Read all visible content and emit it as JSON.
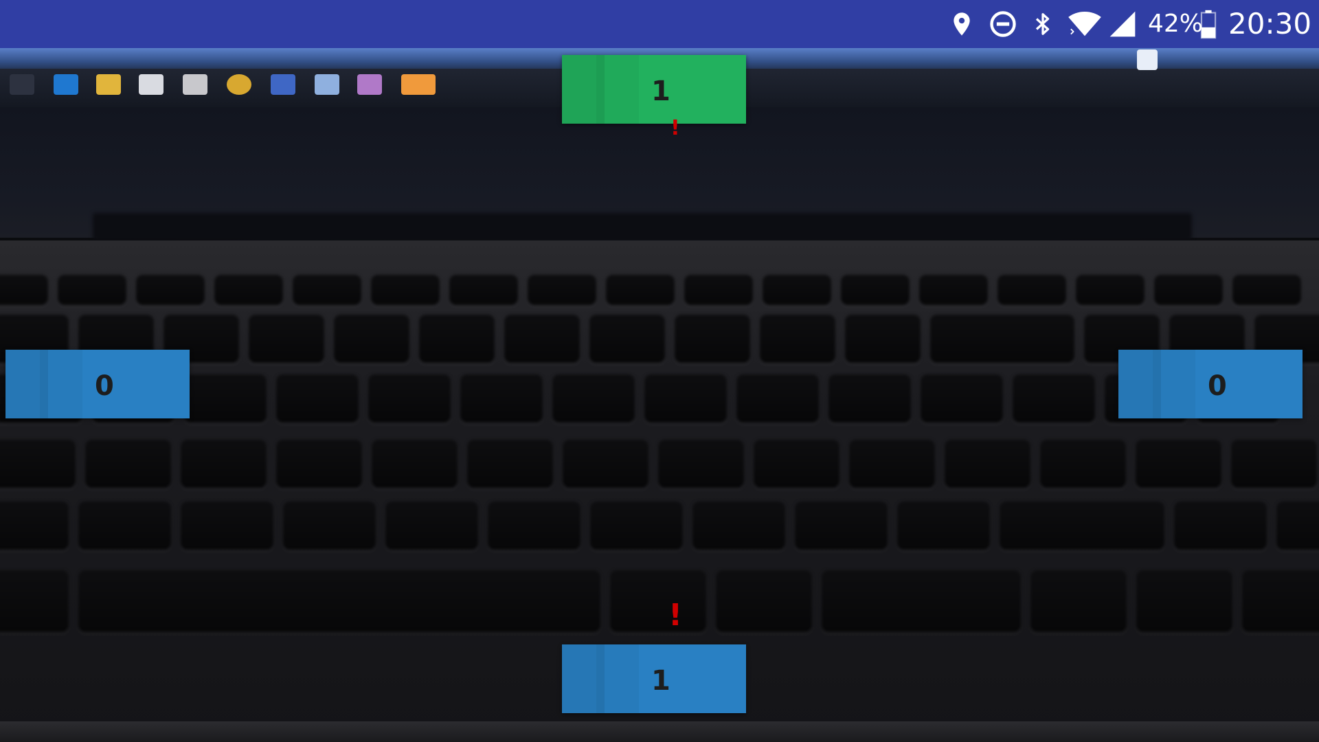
{
  "status_bar": {
    "icons": [
      "location-icon",
      "do-not-disturb-icon",
      "bluetooth-icon",
      "wifi-icon",
      "cellular-signal-icon",
      "battery-icon"
    ],
    "battery": "42%",
    "time": "20:30",
    "background_color": "#303ea4"
  },
  "counters": {
    "top": {
      "value": "1",
      "color": "#22b15e"
    },
    "left": {
      "value": "0",
      "color": "#2980c3"
    },
    "right": {
      "value": "0",
      "color": "#2980c3"
    },
    "bottom": {
      "value": "1",
      "color": "#2980c3"
    }
  },
  "markers": {
    "top": "!",
    "bottom": "!"
  },
  "marker_color": "#d10000"
}
